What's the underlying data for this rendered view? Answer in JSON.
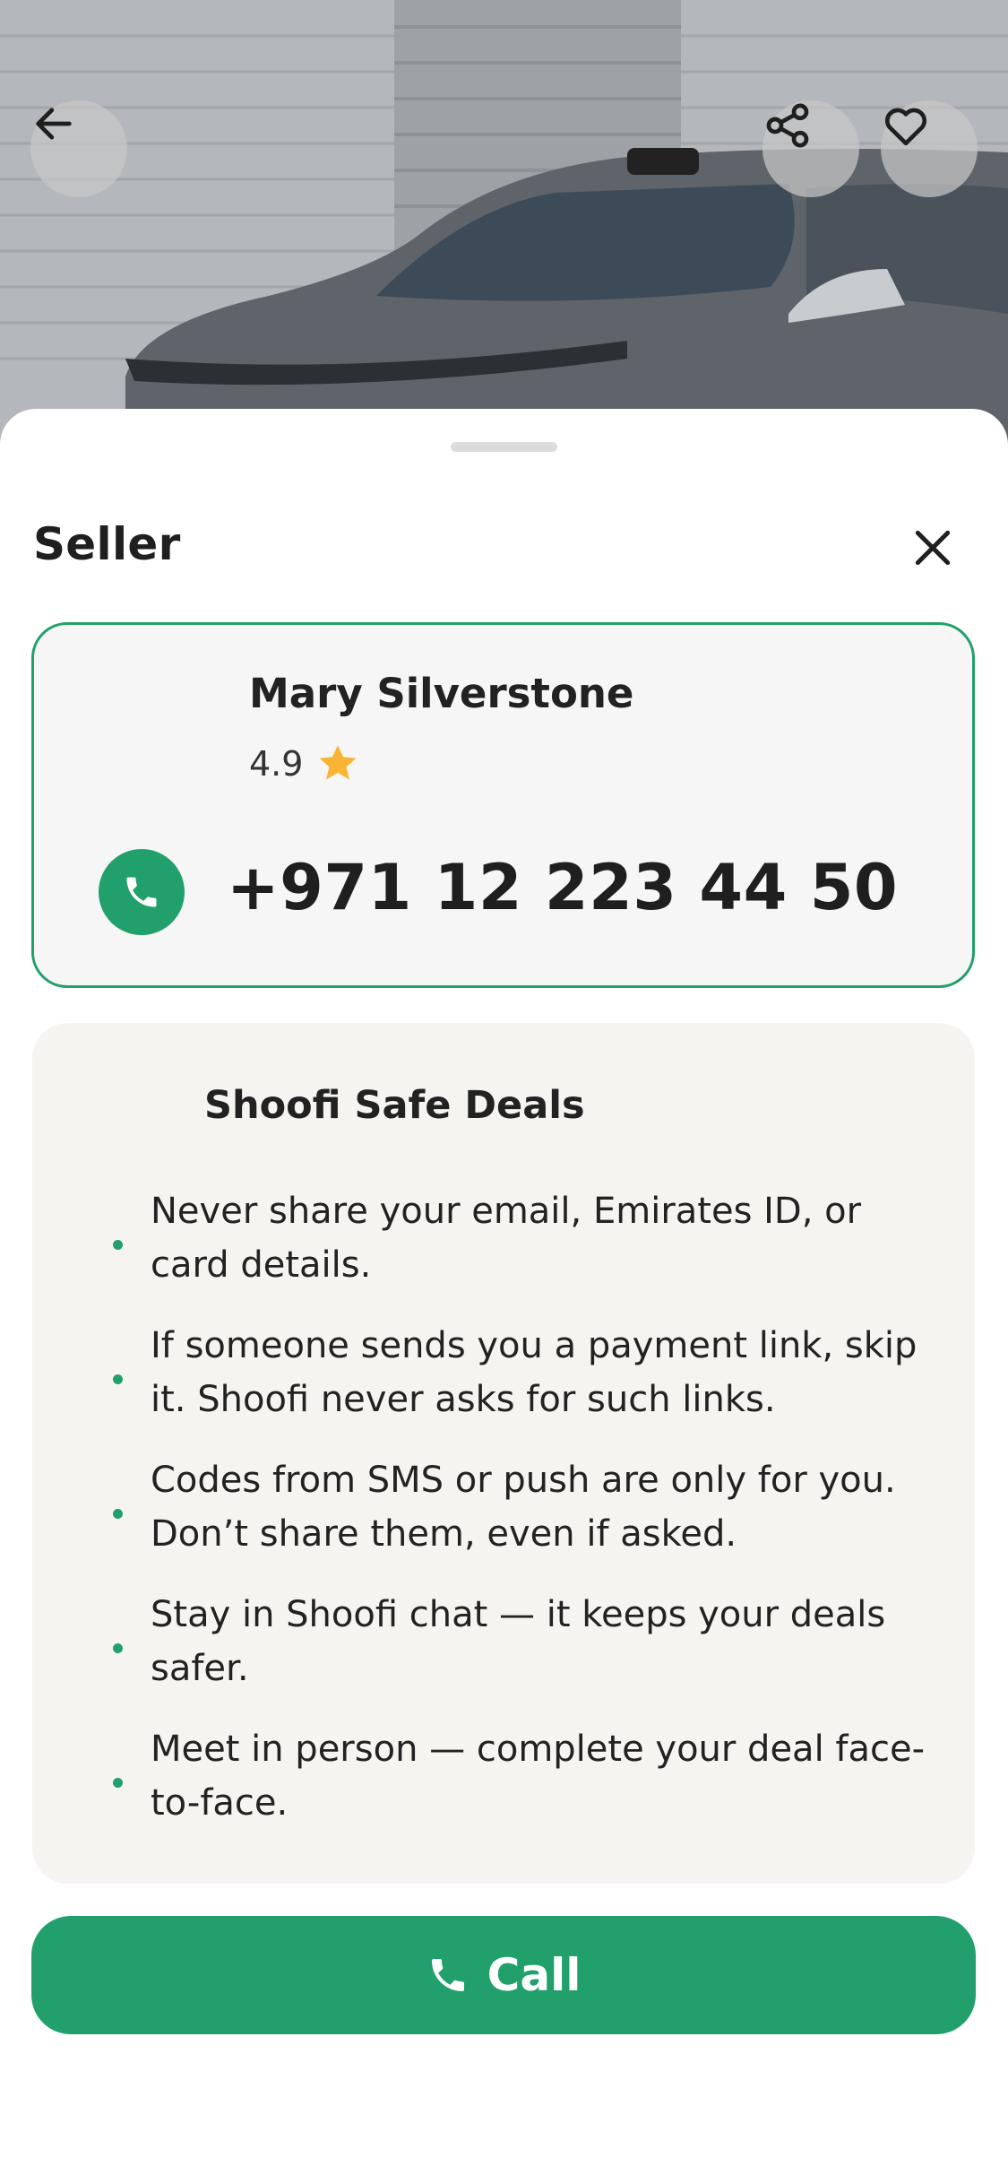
{
  "hero": {
    "back_icon": "arrow-left-icon",
    "share_icon": "share-icon",
    "favorite_icon": "heart-icon"
  },
  "sheet": {
    "title": "Seller",
    "close_icon": "close-icon"
  },
  "seller": {
    "name": "Mary Silverstone",
    "rating": "4.9",
    "rating_icon": "star-icon",
    "phone_icon": "phone-icon",
    "phone": "+971 12 223 44 50"
  },
  "safety": {
    "title": "Shoofi Safe Deals",
    "tips": [
      "Never share your email, Emirates ID, or card details.",
      "If someone sends you a payment link, skip it. Shoofi never asks for such links.",
      "Codes from SMS or push are only for you. Don’t share them, even if asked.",
      "Stay in Shoofi chat — it keeps your deals safer.",
      "Meet in person — complete your deal face-to-face."
    ]
  },
  "call_button": {
    "label": "Call",
    "icon": "phone-icon"
  },
  "colors": {
    "accent": "#22a06b",
    "star": "#f8b535",
    "card_border": "#22a06b",
    "safety_bg": "#f6f4f1"
  }
}
